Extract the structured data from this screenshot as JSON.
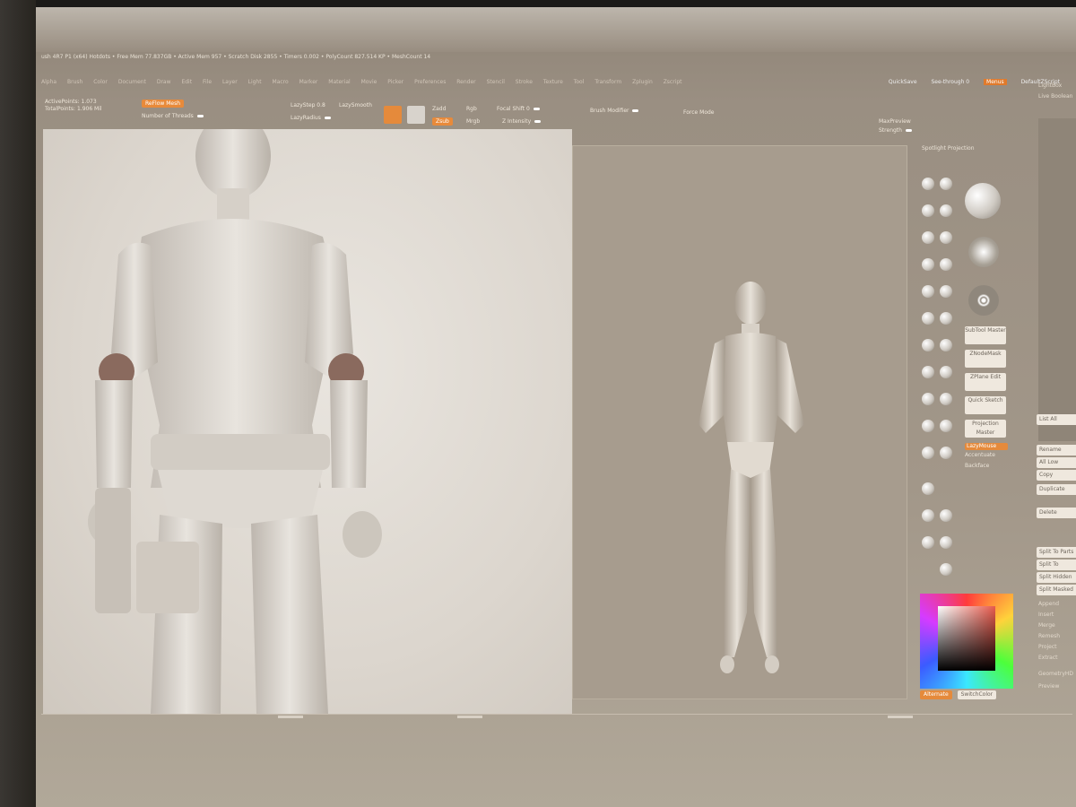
{
  "app": {
    "title_bar": "ush 4R7 P1 (x64)  Hotdots  • Free Mem 77.837GB • Active Mem 957 • Scratch Disk 2855 • Timers 0.002 • PolyCount 827.514 KP • MeshCount 14",
    "menus": [
      "Alpha",
      "Brush",
      "Color",
      "Document",
      "Draw",
      "Edit",
      "File",
      "Layer",
      "Light",
      "Macro",
      "Marker",
      "Material",
      "Movie",
      "Picker",
      "Preferences",
      "Render",
      "Stencil",
      "Stroke",
      "Texture",
      "Tool",
      "Transform",
      "Zplugin",
      "Zscript"
    ],
    "quick_right": [
      "QuickSave",
      "See-through 0",
      "Menus",
      "DefaultZScript"
    ],
    "accent_color": "#e58a3b"
  },
  "top_shelf": {
    "active_points": "ActivePoints: 1.073",
    "total_points": "TotalPoints: 1.906 Mil",
    "mode_button": "ReFlow Mesh",
    "number_threads": "Number of Threads",
    "lazy_step": "LazyStep 0.8",
    "lazy_smooth": "LazySmooth",
    "lazy_radius": "LazyRadius",
    "zadd": "Zadd",
    "zsub": "Zsub",
    "rgb": "Rgb",
    "mrgb": "Mrgb",
    "focal_shift": "Focal Shift 0",
    "z_intensity": "Z Intensity",
    "brush_modifier": "Brush Modifier",
    "force_mode": "Force Mode",
    "max_preview": "MaxPreview",
    "strength": "Strength"
  },
  "mid_tools": {
    "spotlight": "Spotlight Projection",
    "buttons": [
      "SubTool Master",
      "ZNodeMask",
      "ZPlane Edit",
      "Quick Sketch",
      "Projection Master"
    ],
    "orange_button": "LazyMouse",
    "labels": [
      "Accentuate",
      "Backface"
    ],
    "swatch_labels": [
      "Alternate",
      "SwitchColor"
    ]
  },
  "right_panel": {
    "top_labels": [
      "LightBox",
      "Live Boolean"
    ],
    "buttons": [
      "List All",
      "Rename",
      "All Low",
      "Copy",
      "Duplicate",
      "Delete",
      "Split To Parts",
      "Split To Similar",
      "Split Hidden",
      "Split Masked"
    ],
    "labels": [
      "Append",
      "Insert",
      "Merge",
      "Remesh",
      "Project",
      "Extract",
      "GeometryHD",
      "Preview"
    ]
  }
}
